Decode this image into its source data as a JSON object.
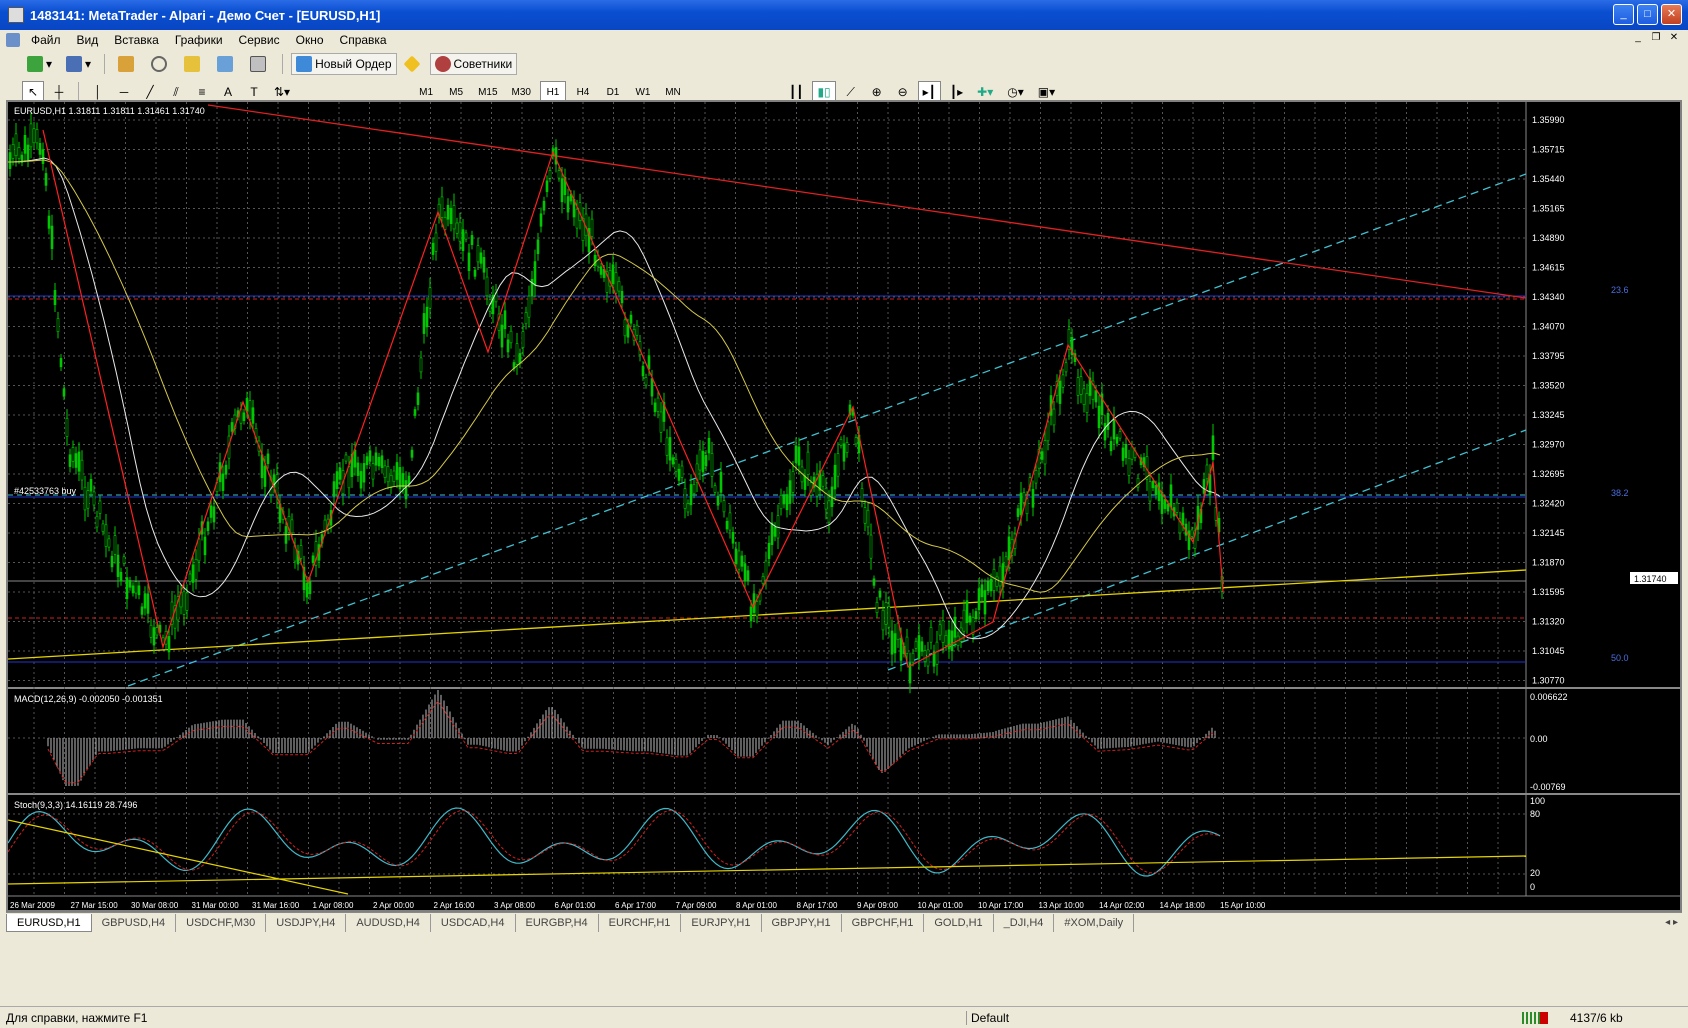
{
  "window": {
    "title": "1483141: MetaTrader - Alpari - Демо Счет - [EURUSD,H1]",
    "buttons": [
      "_",
      "□",
      "✕"
    ]
  },
  "menu": [
    "Файл",
    "Вид",
    "Вставка",
    "Графики",
    "Сервис",
    "Окно",
    "Справка"
  ],
  "toolbar": {
    "new_order": "Новый Ордер",
    "experts": "Советники",
    "timeframes": [
      "M1",
      "M5",
      "M15",
      "M30",
      "H1",
      "H4",
      "D1",
      "W1",
      "MN"
    ],
    "active_timeframe": "H1"
  },
  "chart": {
    "header": "EURUSD,H1  1.31811 1.31811 1.31461 1.31740",
    "order_label": "#42533763 buy",
    "price_ticks": [
      "1.35990",
      "1.35715",
      "1.35440",
      "1.35165",
      "1.34890",
      "1.34615",
      "1.34340",
      "1.34070",
      "1.33795",
      "1.33520",
      "1.33245",
      "1.32970",
      "1.32695",
      "1.32420",
      "1.32145",
      "1.31870",
      "1.31595",
      "1.31320",
      "1.31045",
      "1.30770"
    ],
    "current_price": "1.31740",
    "fibo_labels": [
      "23.6",
      "38.2",
      "50.0"
    ],
    "macd_header": "MACD(12,26,9) -0.002050 -0.001351",
    "macd_ticks": [
      "0.006622",
      "0.00",
      "-0.00769"
    ],
    "stoch_header": "Stoch(9,3,3) 14.16119 28.7496",
    "stoch_ticks": [
      "100",
      "80",
      "20",
      "0"
    ],
    "time_ticks": [
      "26 Mar 2009",
      "27 Mar 15:00",
      "30 Mar 08:00",
      "31 Mar 00:00",
      "31 Mar 16:00",
      "1 Apr 08:00",
      "2 Apr 00:00",
      "2 Apr 16:00",
      "3 Apr 08:00",
      "6 Apr 01:00",
      "6 Apr 17:00",
      "7 Apr 09:00",
      "8 Apr 01:00",
      "8 Apr 17:00",
      "9 Apr 09:00",
      "10 Apr 01:00",
      "10 Apr 17:00",
      "13 Apr 10:00",
      "14 Apr 02:00",
      "14 Apr 18:00",
      "15 Apr 10:00"
    ],
    "colors": {
      "candle": "#00c800",
      "zigzag": "#ff2020",
      "ma_slow": "#d4c84a",
      "ma_fast": "#e8e8e8",
      "fibo": "#3344dd",
      "channel": "#40c0d0",
      "trend": "#e6d400"
    }
  },
  "tabs": [
    "EURUSD,H1",
    "GBPUSD,H4",
    "USDCHF,M30",
    "USDJPY,H4",
    "AUDUSD,H4",
    "USDCAD,H4",
    "EURGBP,H4",
    "EURCHF,H1",
    "EURJPY,H1",
    "GBPJPY,H1",
    "GBPCHF,H1",
    "GOLD,H1",
    "_DJI,H4",
    "#XOM,Daily"
  ],
  "status": {
    "help": "Для справки, нажмите F1",
    "profile": "Default",
    "traffic": "4137/6 kb"
  }
}
